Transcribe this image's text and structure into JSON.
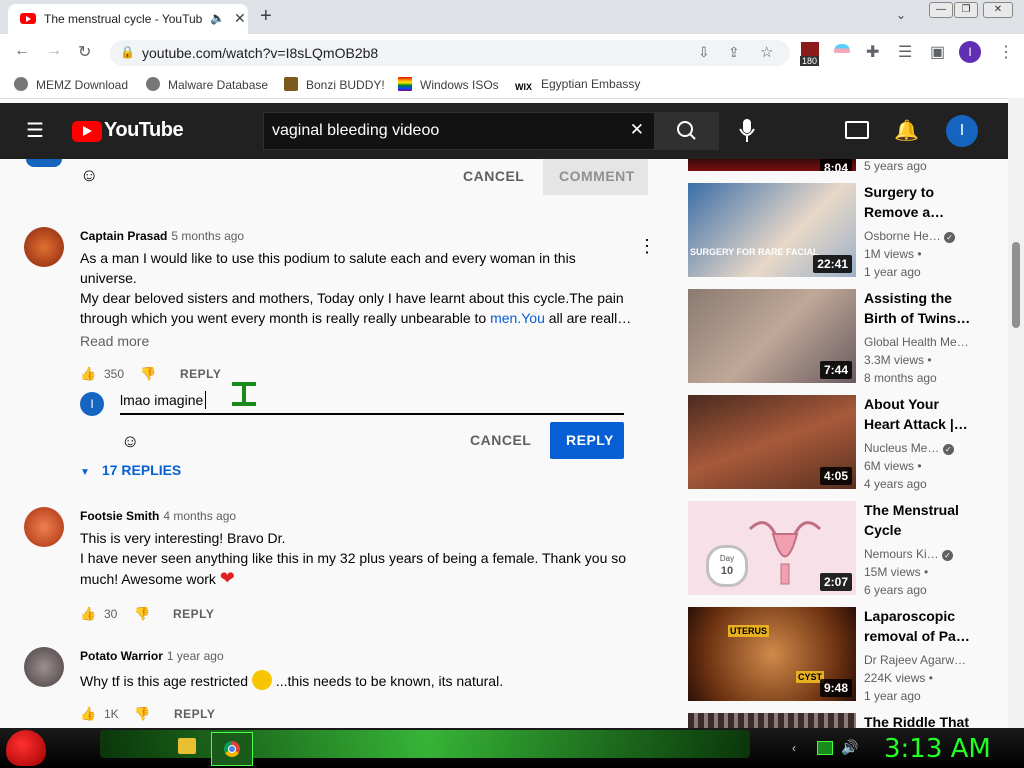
{
  "browser": {
    "tab_title": "The menstrual cycle - YouTub",
    "url": "youtube.com/watch?v=I8sLQmOB2b8",
    "profile_initial": "I",
    "bookmarks": [
      "MEMZ Download",
      "Malware Database",
      "Bonzi BUDDY!",
      "Windows ISOs",
      "Egyptian Embassy"
    ],
    "extension_badge": "180"
  },
  "youtube": {
    "logo_text": "YouTube",
    "search_value": "vaginal bleeding videoo",
    "avatar_initial": "I"
  },
  "top_composer": {
    "cancel": "CANCEL",
    "comment": "COMMENT"
  },
  "comments": [
    {
      "author": "Captain Prasad",
      "time": "5 months ago",
      "lines": [
        "As a man I would like to use this podium to salute each and every woman in this",
        "universe.",
        "My dear beloved sisters and mothers, Today only I have learnt about this cycle.The pain",
        "through which you went every month is really really unbearable to "
      ],
      "link": "men.You",
      "tail": " all are reall…",
      "read_more": "Read more",
      "likes": "350",
      "reply_label": "REPLY",
      "reply_box": {
        "avatar_initial": "I",
        "value": "lmao imagine",
        "cancel": "CANCEL",
        "reply": "REPLY"
      },
      "replies_toggle": "17 REPLIES"
    },
    {
      "author": "Footsie Smith",
      "time": "4 months ago",
      "lines": [
        "This is very interesting! Bravo Dr.",
        "I have never seen anything like this in my 32 plus years of being a female. Thank you so",
        "much! Awesome work"
      ],
      "likes": "30",
      "reply_label": "REPLY"
    },
    {
      "author": "Potato Warrior",
      "time": "1 year ago",
      "lines": [
        "Why tf is this age restricted",
        " ...this needs to be known, its natural."
      ],
      "likes": "1K",
      "reply_label": "REPLY"
    }
  ],
  "sidebar": [
    {
      "title": "",
      "channel": "",
      "views": "",
      "age": "5 years ago",
      "duration": "8:04"
    },
    {
      "title": "Surgery to Remove a…",
      "title2": "Remove a…",
      "title1": "Surgery to",
      "channel": "Osborne He…",
      "views": "1M views •",
      "age": "1 year ago",
      "duration": "22:41"
    },
    {
      "title1": "Assisting the",
      "title2": "Birth of Twins…",
      "channel": "Global Health Me…",
      "views": "3.3M views •",
      "age": "8 months ago",
      "duration": "7:44"
    },
    {
      "title1": "About Your",
      "title2": "Heart Attack |…",
      "channel": "Nucleus Me…",
      "views": "6M views •",
      "age": "4 years ago",
      "duration": "4:05"
    },
    {
      "title1": "The Menstrual",
      "title2": "Cycle",
      "channel": "Nemours Ki…",
      "views": "15M views •",
      "age": "6 years ago",
      "duration": "2:07"
    },
    {
      "title1": "Laparoscopic",
      "title2": "removal of Pa…",
      "channel": "Dr Rajeev Agarw…",
      "views": "224K views •",
      "age": "1 year ago",
      "duration": "9:48"
    },
    {
      "title1": "The Riddle That",
      "title2": ""
    }
  ],
  "thumb_text": {
    "surgery": "SURGERY FOR RARE FACIAL",
    "uterus": "UTERUS",
    "cyst": "CYST",
    "day": "Day",
    "day_num": "10"
  },
  "taskbar": {
    "clock": "3:13 AM"
  },
  "colors": {
    "accent": "#065fd4",
    "youtube_red": "#ff0000",
    "clock": "#22ff22"
  }
}
